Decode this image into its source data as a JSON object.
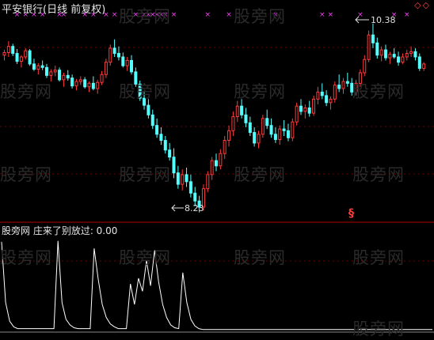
{
  "main_title": "平安银行(日线 前复权)",
  "indicator_title": "股旁网 庄来了别放过: 0.00",
  "high_label": "10.38",
  "low_label": "8.23",
  "signal_char": "§",
  "corner_marks": "◇◇",
  "watermark": "股旁网",
  "colors": {
    "up": "#ff3b3b",
    "down": "#54ffff",
    "indicator": "#ffffff",
    "marker": "#ff40ff",
    "separator": "#b00000",
    "grid": "#6b0000"
  },
  "chart_data": {
    "type": "candlestick",
    "candles": [
      [
        10.02,
        10.08,
        9.96,
        10.05
      ],
      [
        10.05,
        10.18,
        10.0,
        10.12
      ],
      [
        10.12,
        10.15,
        10.01,
        10.04
      ],
      [
        10.04,
        10.09,
        9.92,
        9.95
      ],
      [
        9.95,
        10.02,
        9.88,
        10.0
      ],
      [
        10.0,
        10.1,
        9.97,
        10.07
      ],
      [
        10.07,
        10.09,
        9.9,
        9.92
      ],
      [
        9.92,
        9.98,
        9.84,
        9.86
      ],
      [
        9.86,
        9.93,
        9.8,
        9.9
      ],
      [
        9.9,
        9.96,
        9.85,
        9.88
      ],
      [
        9.88,
        9.92,
        9.76,
        9.79
      ],
      [
        9.79,
        9.86,
        9.72,
        9.83
      ],
      [
        9.83,
        9.9,
        9.78,
        9.85
      ],
      [
        9.85,
        9.88,
        9.72,
        9.74
      ],
      [
        9.74,
        9.82,
        9.66,
        9.79
      ],
      [
        9.79,
        9.85,
        9.73,
        9.76
      ],
      [
        9.76,
        9.8,
        9.64,
        9.67
      ],
      [
        9.67,
        9.75,
        9.62,
        9.72
      ],
      [
        9.72,
        9.78,
        9.68,
        9.74
      ],
      [
        9.74,
        9.77,
        9.64,
        9.66
      ],
      [
        9.66,
        9.72,
        9.6,
        9.7
      ],
      [
        9.7,
        9.78,
        9.62,
        9.64
      ],
      [
        9.64,
        9.74,
        9.58,
        9.71
      ],
      [
        9.71,
        9.84,
        9.68,
        9.8
      ],
      [
        9.8,
        9.98,
        9.76,
        9.94
      ],
      [
        9.94,
        10.14,
        9.9,
        10.1
      ],
      [
        10.1,
        10.2,
        10.0,
        10.04
      ],
      [
        10.04,
        10.12,
        9.96,
        10.0
      ],
      [
        10.0,
        10.05,
        9.88,
        9.9
      ],
      [
        9.9,
        10.0,
        9.84,
        9.96
      ],
      [
        9.96,
        10.02,
        9.8,
        9.83
      ],
      [
        9.83,
        9.88,
        9.66,
        9.69
      ],
      [
        9.69,
        9.73,
        9.5,
        9.53
      ],
      [
        9.53,
        9.6,
        9.4,
        9.45
      ],
      [
        9.45,
        9.52,
        9.3,
        9.34
      ],
      [
        9.34,
        9.4,
        9.18,
        9.22
      ],
      [
        9.22,
        9.3,
        9.08,
        9.12
      ],
      [
        9.12,
        9.2,
        9.0,
        9.05
      ],
      [
        9.05,
        9.1,
        8.9,
        8.94
      ],
      [
        8.94,
        9.02,
        8.82,
        8.86
      ],
      [
        8.86,
        8.96,
        8.62,
        8.68
      ],
      [
        8.68,
        8.76,
        8.5,
        8.55
      ],
      [
        8.55,
        8.72,
        8.48,
        8.66
      ],
      [
        8.66,
        8.74,
        8.52,
        8.58
      ],
      [
        8.58,
        8.66,
        8.4,
        8.45
      ],
      [
        8.45,
        8.52,
        8.3,
        8.36
      ],
      [
        8.36,
        8.42,
        8.23,
        8.29
      ],
      [
        8.29,
        8.55,
        8.25,
        8.5
      ],
      [
        8.5,
        8.7,
        8.46,
        8.66
      ],
      [
        8.66,
        8.86,
        8.6,
        8.82
      ],
      [
        8.82,
        8.9,
        8.7,
        8.76
      ],
      [
        8.76,
        8.95,
        8.72,
        8.9
      ],
      [
        8.9,
        9.1,
        8.84,
        9.05
      ],
      [
        9.05,
        9.22,
        8.98,
        9.16
      ],
      [
        9.16,
        9.38,
        9.1,
        9.32
      ],
      [
        9.32,
        9.5,
        9.26,
        9.44
      ],
      [
        9.44,
        9.52,
        9.3,
        9.34
      ],
      [
        9.34,
        9.42,
        9.2,
        9.25
      ],
      [
        9.25,
        9.32,
        9.1,
        9.14
      ],
      [
        9.14,
        9.2,
        8.98,
        9.02
      ],
      [
        9.02,
        9.16,
        8.96,
        9.12
      ],
      [
        9.12,
        9.34,
        9.08,
        9.3
      ],
      [
        9.3,
        9.4,
        9.18,
        9.22
      ],
      [
        9.22,
        9.3,
        9.08,
        9.12
      ],
      [
        9.12,
        9.2,
        9.02,
        9.06
      ],
      [
        9.06,
        9.22,
        9.0,
        9.18
      ],
      [
        9.18,
        9.28,
        9.1,
        9.16
      ],
      [
        9.16,
        9.24,
        9.04,
        9.08
      ],
      [
        9.08,
        9.3,
        9.04,
        9.26
      ],
      [
        9.26,
        9.48,
        9.22,
        9.44
      ],
      [
        9.44,
        9.52,
        9.34,
        9.38
      ],
      [
        9.38,
        9.46,
        9.3,
        9.42
      ],
      [
        9.42,
        9.5,
        9.32,
        9.36
      ],
      [
        9.36,
        9.56,
        9.33,
        9.52
      ],
      [
        9.52,
        9.66,
        9.46,
        9.6
      ],
      [
        9.6,
        9.7,
        9.52,
        9.56
      ],
      [
        9.56,
        9.62,
        9.44,
        9.48
      ],
      [
        9.48,
        9.55,
        9.4,
        9.52
      ],
      [
        9.52,
        9.72,
        9.48,
        9.68
      ],
      [
        9.68,
        9.8,
        9.6,
        9.64
      ],
      [
        9.64,
        9.76,
        9.58,
        9.72
      ],
      [
        9.72,
        9.82,
        9.66,
        9.7
      ],
      [
        9.7,
        9.76,
        9.56,
        9.6
      ],
      [
        9.6,
        9.74,
        9.56,
        9.7
      ],
      [
        9.7,
        9.86,
        9.66,
        9.82
      ],
      [
        9.82,
        10.02,
        9.78,
        9.97
      ],
      [
        9.97,
        10.3,
        9.94,
        10.25
      ],
      [
        10.25,
        10.38,
        10.1,
        10.16
      ],
      [
        10.16,
        10.22,
        9.98,
        10.02
      ],
      [
        10.02,
        10.12,
        9.95,
        10.08
      ],
      [
        10.08,
        10.14,
        9.96,
        9.99
      ],
      [
        9.99,
        10.06,
        9.92,
        10.03
      ],
      [
        10.03,
        10.1,
        9.98,
        10.0
      ],
      [
        10.0,
        10.06,
        9.9,
        9.94
      ],
      [
        9.94,
        10.04,
        9.92,
        10.0
      ],
      [
        10.0,
        10.08,
        9.96,
        10.04
      ],
      [
        10.04,
        10.12,
        10.0,
        10.06
      ],
      [
        10.06,
        10.1,
        9.96,
        10.0
      ],
      [
        10.0,
        10.04,
        9.84,
        9.87
      ],
      [
        9.87,
        9.94,
        9.84,
        9.92
      ]
    ],
    "ylim": [
      8.2,
      10.45
    ],
    "indicator": [
      0.95,
      0.3,
      0.1,
      0.04,
      0.02,
      0.02,
      0.02,
      0.02,
      0.02,
      0.02,
      0.02,
      0.02,
      0.02,
      0.02,
      0.96,
      0.3,
      0.12,
      0.06,
      0.03,
      0.02,
      0.02,
      0.02,
      0.02,
      0.88,
      0.55,
      0.28,
      0.14,
      0.07,
      0.04,
      0.02,
      0.02,
      0.02,
      0.5,
      0.28,
      0.56,
      0.42,
      0.75,
      0.48,
      0.86,
      0.52,
      0.28,
      0.14,
      0.06,
      0.03,
      0.02,
      0.62,
      0.3,
      0.12,
      0.05,
      0.02,
      0.01,
      0.01,
      0.01,
      0.01,
      0.01,
      0.01,
      0.01,
      0.01,
      0.01,
      0.01,
      0.01,
      0.01,
      0.01,
      0.01,
      0.01,
      0.01,
      0.01,
      0.01,
      0.01,
      0.01,
      0.01,
      0.01,
      0.01,
      0.01,
      0.01,
      0.01,
      0.01,
      0.01,
      0.01,
      0.01,
      0.01,
      0.01,
      0.01,
      0.01,
      0.01,
      0.01,
      0.01,
      0.01,
      0.01,
      0.01,
      0.01,
      0.01,
      0.01,
      0.01,
      0.01,
      0.01,
      0.01,
      0.01,
      0.01,
      0.01,
      0.01,
      0.01,
      0.01,
      0.01,
      0.01,
      0.01,
      0.01,
      0.01
    ],
    "marker_indices": [
      3,
      5,
      7,
      9,
      13,
      14,
      19,
      21,
      24,
      26,
      31,
      33,
      34,
      35,
      36,
      37,
      38,
      40,
      48,
      53,
      64,
      75,
      77,
      84,
      92,
      95
    ],
    "yellow_markers": [
      42
    ]
  }
}
